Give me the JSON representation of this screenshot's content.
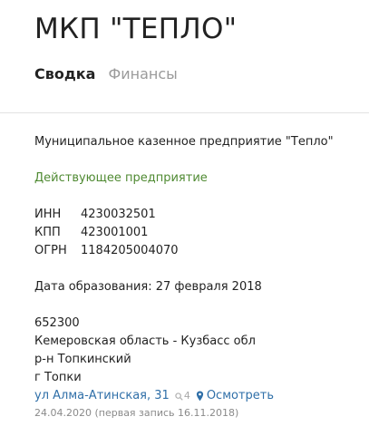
{
  "header": {
    "title": "МКП \"ТЕПЛО\""
  },
  "tabs": [
    {
      "label": "Сводка",
      "active": true
    },
    {
      "label": "Финансы",
      "active": false
    }
  ],
  "company": {
    "full_name": "Муниципальное казенное предприятие \"Тепло\"",
    "status": "Действующее предприятие",
    "codes": [
      {
        "label": "ИНН",
        "value": "4230032501"
      },
      {
        "label": "КПП",
        "value": "423001001"
      },
      {
        "label": "ОГРН",
        "value": "1184205004070"
      }
    ],
    "registration": "Дата образования: 27 февраля 2018"
  },
  "address": {
    "postcode": "652300",
    "region": "Кемеровская область - Кузбасс обл",
    "district": "р-н Топкинский",
    "city": "г Топки",
    "street": "ул Алма-Атинская, 31",
    "search_count": "4",
    "view_label": "Осмотреть",
    "record_dates": "24.04.2020 (первая запись 16.11.2018)"
  },
  "colors": {
    "status": "#4f8a32",
    "link": "#2f6fa8"
  },
  "icons": {
    "search": "search-icon",
    "map_pin": "map-pin-icon"
  }
}
